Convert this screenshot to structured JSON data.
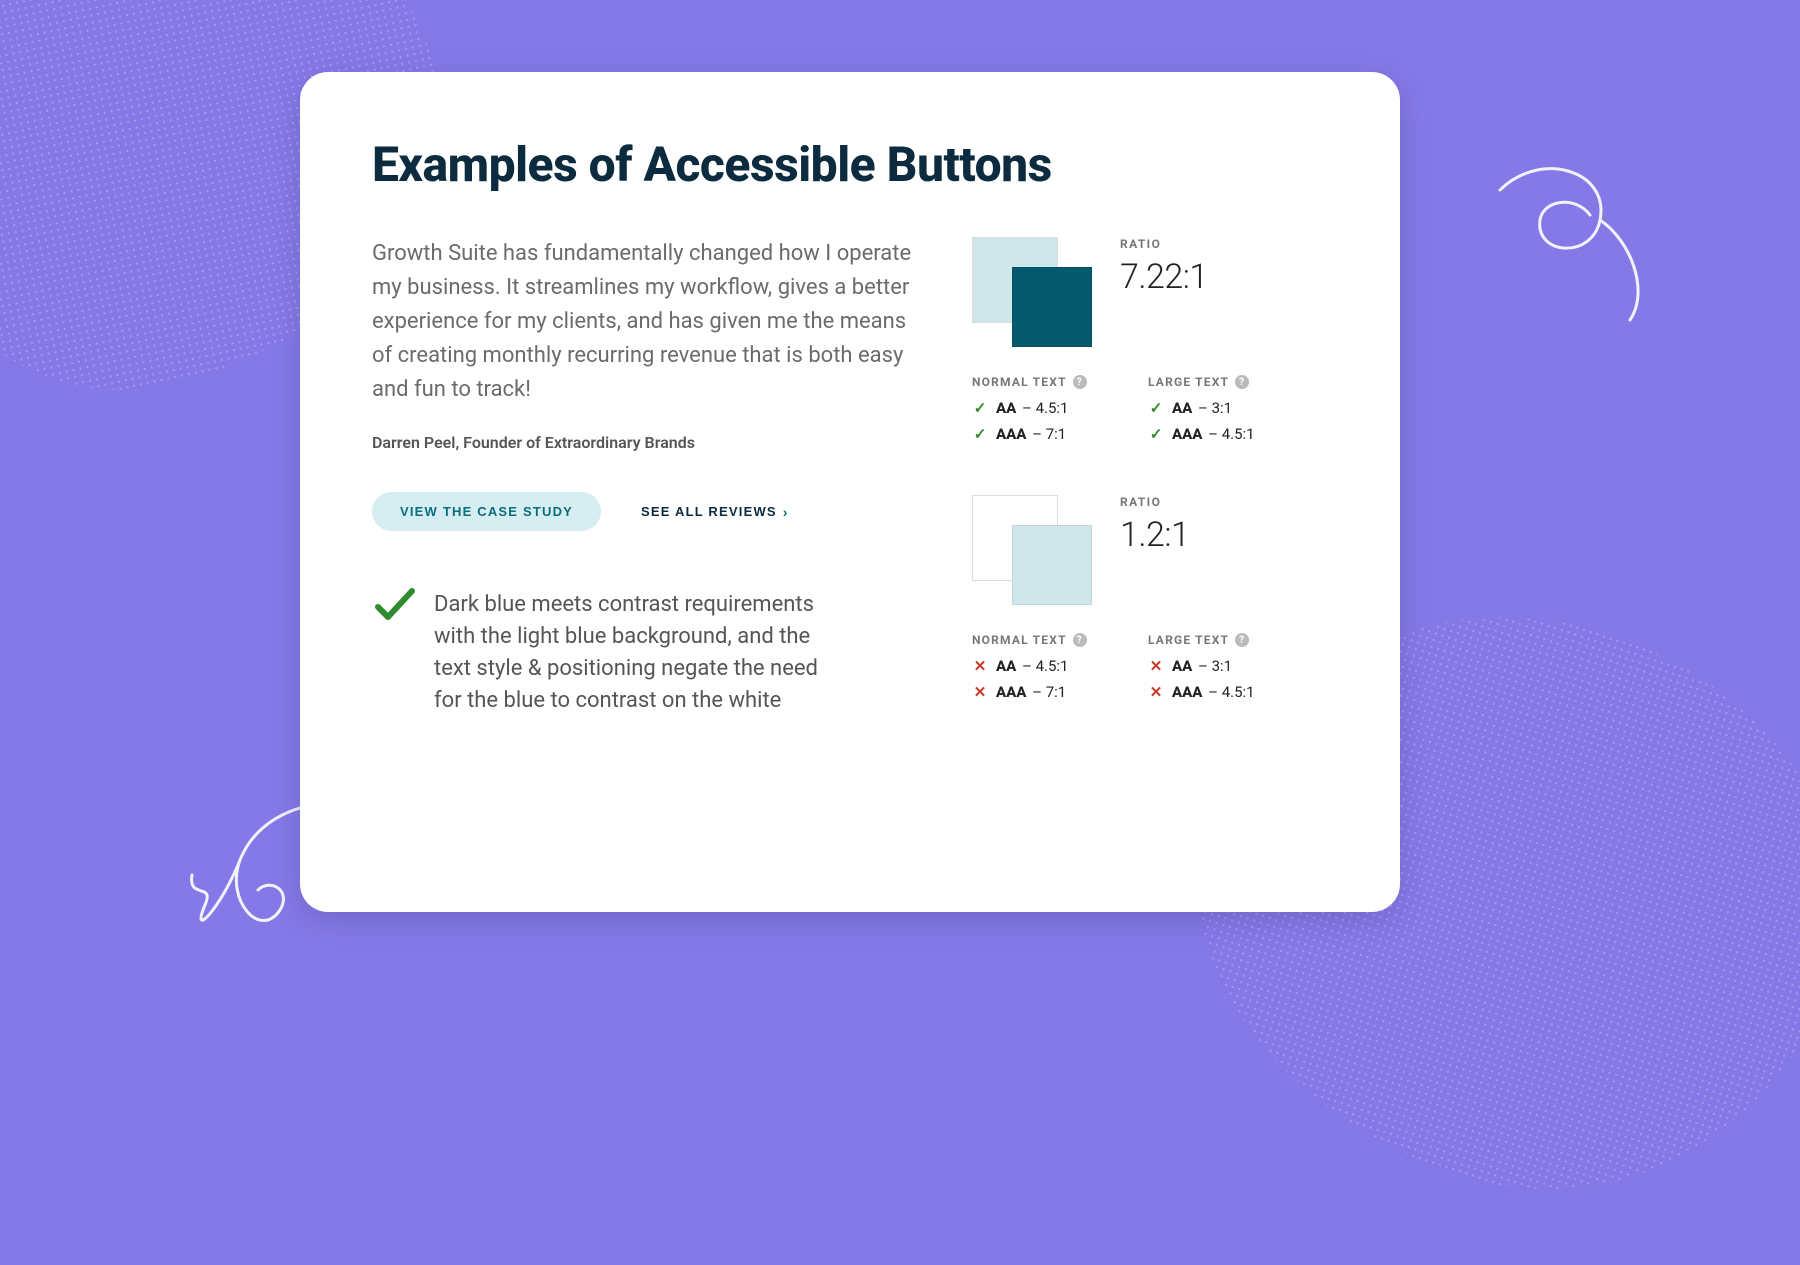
{
  "heading": "Examples of Accessible Buttons",
  "quote": "Growth Suite has fundamentally changed how I operate my business. It streamlines my workflow, gives a better experience for my clients, and has given me the means of creating monthly recurring revenue that is both easy and fun to track!",
  "attribution": "Darren Peel, Founder of Extraordinary Brands",
  "cta_primary": "VIEW THE CASE STUDY",
  "cta_secondary": "SEE ALL REVIEWS",
  "note_text": "Dark blue meets contrast requirements with the light blue background, and the text style & positioning negate the need for the blue to contrast on the white",
  "ratio_label": "RATIO",
  "normal_text_label": "NORMAL TEXT",
  "large_text_label": "LARGE TEXT",
  "samples": [
    {
      "swatch_back": "#cfe7ea",
      "swatch_front": "#065a6d",
      "ratio": "7.22:1",
      "normal": [
        {
          "pass": true,
          "level": "AA",
          "req": "4.5:1"
        },
        {
          "pass": true,
          "level": "AAA",
          "req": "7:1"
        }
      ],
      "large": [
        {
          "pass": true,
          "level": "AA",
          "req": "3:1"
        },
        {
          "pass": true,
          "level": "AAA",
          "req": "4.5:1"
        }
      ]
    },
    {
      "swatch_back": "#ffffff",
      "swatch_front": "#cfe7ea",
      "ratio": "1.2:1",
      "normal": [
        {
          "pass": false,
          "level": "AA",
          "req": "4.5:1"
        },
        {
          "pass": false,
          "level": "AAA",
          "req": "7:1"
        }
      ],
      "large": [
        {
          "pass": false,
          "level": "AA",
          "req": "3:1"
        },
        {
          "pass": false,
          "level": "AAA",
          "req": "4.5:1"
        }
      ]
    }
  ]
}
